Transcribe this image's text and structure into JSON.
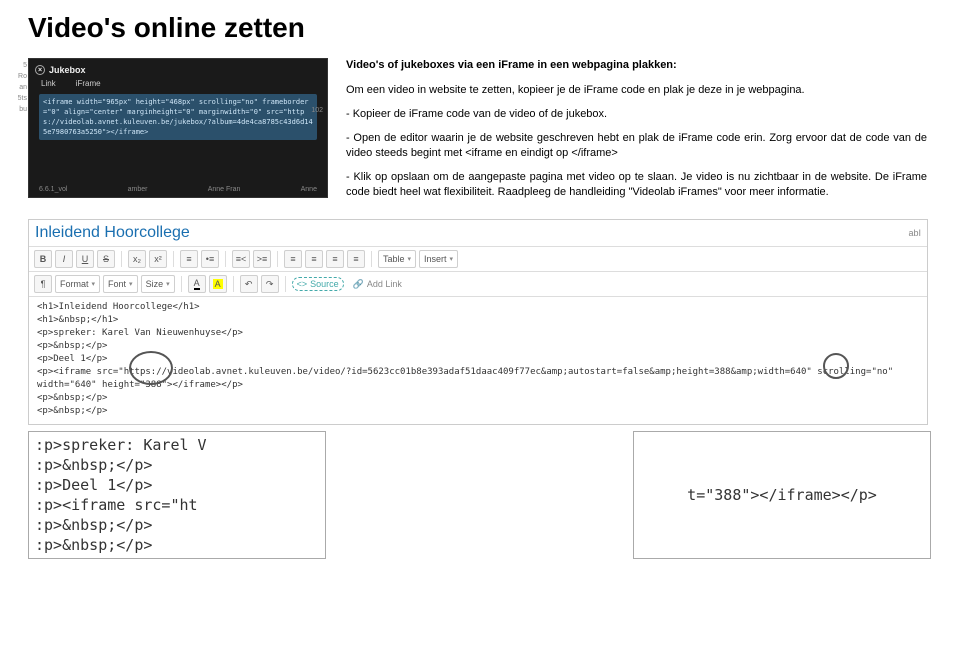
{
  "title": "Video's online zetten",
  "subtitle": "Video's of jukeboxes via een iFrame in een webpagina plakken:",
  "intro": "Om een video in website te zetten, kopieer je de iFrame code en plak je deze in je webpagina.",
  "bullet1": "- Kopieer de iFrame code van de video of de jukebox.",
  "bullet2": "- Open de editor waarin je de website geschreven hebt en plak de iFrame code erin. Zorg ervoor dat de code van de video steeds begint met <iframe en eindigt op </iframe>",
  "bullet3": "- Klik op opslaan om de aangepaste pagina met video op te slaan. Je video is nu zichtbaar in de website. De iFrame code biedt heel wat flexibiliteit. Raadpleeg de handleiding \"Videolab iFrames\" voor meer informatie.",
  "jukebox": {
    "title": "Jukebox",
    "tab_link": "Link",
    "tab_iframe": "iFrame",
    "code": "<iframe width=\"965px\" height=\"468px\" scrolling=\"no\" frameborder=\"0\" align=\"center\" marginheight=\"0\" marginwidth=\"0\" src=\"https://videolab.avnet.kuleuven.be/jukebox/?album=4de4ca8785c43d6d145e7980763a5250\"></iframe>",
    "side": [
      "5",
      "",
      "",
      "",
      "",
      "Ro",
      "an",
      "5ts",
      "bu"
    ],
    "num102": "102",
    "bottom": [
      "6.6.1_vol",
      "amber",
      "Anne Fran",
      "Anne"
    ]
  },
  "editor": {
    "page_title": "Inleidend Hoorcollege",
    "abi": "abI",
    "format": "Format",
    "font": "Font",
    "size": "Size",
    "table": "Table",
    "insert": "Insert",
    "source": "Source",
    "addlink": "Add Link",
    "code_lines": [
      "<h1>Inleidend Hoorcollege</h1>",
      "<h1>&nbsp;</h1>",
      "<p>spreker: Karel Van Nieuwenhuyse</p>",
      "<p>&nbsp;</p>",
      "<p>Deel 1</p>",
      "<p><iframe src=\"https://videolab.avnet.kuleuven.be/video/?id=5623cc01b8e393adaf51daac409f77ec&amp;autostart=false&amp;height=388&amp;width=640\" scrolling=\"no\" width=\"640\" height=\"388\"></iframe></p>",
      "<p>&nbsp;</p>",
      "<p>&nbsp;</p>"
    ]
  },
  "zoom": {
    "left_lines": [
      ":p>spreker: Karel V",
      ":p>&nbsp;</p>",
      ":p>Deel 1</p>",
      ":p><iframe src=\"ht",
      ":p>&nbsp;</p>",
      ":p>&nbsp;</p>"
    ],
    "right": "t=\"388\"></iframe></p>"
  }
}
